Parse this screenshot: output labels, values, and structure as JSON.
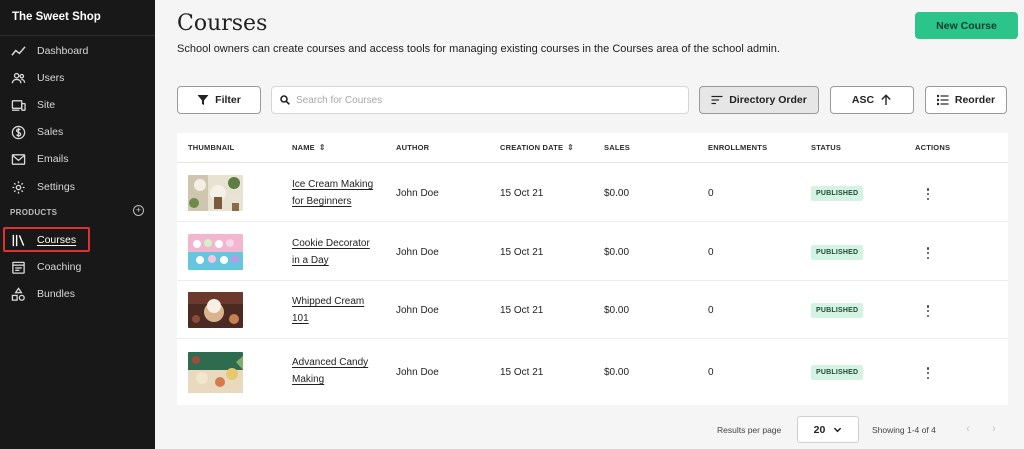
{
  "sidebar": {
    "brand": "The Sweet Shop",
    "items": [
      {
        "label": "Dashboard",
        "icon": "chart-line-icon"
      },
      {
        "label": "Users",
        "icon": "users-icon"
      },
      {
        "label": "Site",
        "icon": "devices-icon"
      },
      {
        "label": "Sales",
        "icon": "dollar-circle-icon"
      },
      {
        "label": "Emails",
        "icon": "mail-icon"
      },
      {
        "label": "Settings",
        "icon": "gear-icon"
      }
    ],
    "products_section": {
      "label": "PRODUCTS",
      "add_glyph": "+",
      "items": [
        {
          "label": "Courses",
          "icon": "library-icon",
          "active": true
        },
        {
          "label": "Coaching",
          "icon": "calendar-icon"
        },
        {
          "label": "Bundles",
          "icon": "shapes-icon"
        }
      ]
    },
    "highlight_color": "#e03131"
  },
  "header": {
    "title": "Courses",
    "subtitle": "School owners can create courses and access tools for managing existing courses in the Courses area of the school admin.",
    "new_course_label": "New Course"
  },
  "toolbar": {
    "filter_label": "Filter",
    "search_placeholder": "Search for Courses",
    "search_value": "",
    "directory_order_label": "Directory Order",
    "asc_label": "ASC",
    "reorder_label": "Reorder"
  },
  "table": {
    "columns": [
      "THUMBNAIL",
      "NAME",
      "AUTHOR",
      "CREATION DATE",
      "SALES",
      "ENROLLMENTS",
      "STATUS",
      "ACTIONS"
    ],
    "sort_glyph": "⇕",
    "rows": [
      {
        "name_line1": "Ice Cream Making",
        "name_line2": "for Beginners",
        "author": "John Doe",
        "created": "15 Oct 21",
        "sales": "$0.00",
        "enrollments": "0",
        "status": "PUBLISHED"
      },
      {
        "name_line1": "Cookie Decorator",
        "name_line2": "in a Day",
        "author": "John Doe",
        "created": "15 Oct 21",
        "sales": "$0.00",
        "enrollments": "0",
        "status": "PUBLISHED"
      },
      {
        "name_line1": "Whipped Cream",
        "name_line2": "101",
        "author": "John Doe",
        "created": "15 Oct 21",
        "sales": "$0.00",
        "enrollments": "0",
        "status": "PUBLISHED"
      },
      {
        "name_line1": "Advanced Candy",
        "name_line2": "Making",
        "author": "John Doe",
        "created": "15 Oct 21",
        "sales": "$0.00",
        "enrollments": "0",
        "status": "PUBLISHED"
      }
    ]
  },
  "pagination": {
    "results_per_page_label": "Results per page",
    "results_per_page_value": "20",
    "showing_label": "Showing 1-4 of 4",
    "prev_glyph": "‹",
    "next_glyph": "›"
  },
  "colors": {
    "accent": "#2bc48a",
    "sidebar_bg": "#181818",
    "badge_bg": "#d4f3e4"
  }
}
